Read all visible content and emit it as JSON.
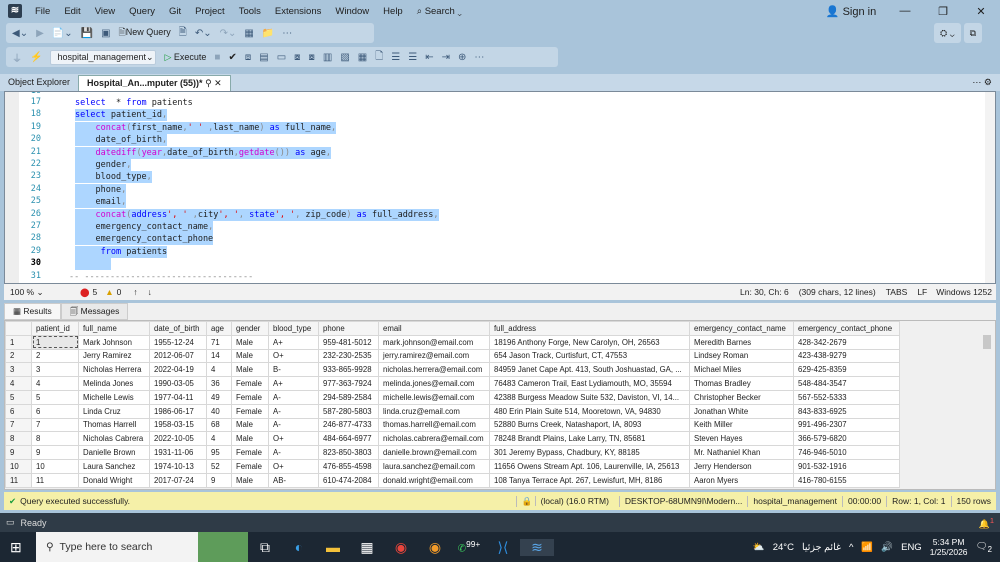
{
  "menu": {
    "items": [
      "File",
      "Edit",
      "View",
      "Query",
      "Git",
      "Project",
      "Tools",
      "Extensions",
      "Window",
      "Help"
    ],
    "search": "Search",
    "sign_in": "Sign in"
  },
  "toolbar": {
    "new_query": "New Query",
    "database": "hospital_management",
    "execute": "Execute"
  },
  "tabs": {
    "object_explorer": "Object Explorer",
    "query_tab": "Hospital_An...mputer (55))*"
  },
  "editor": {
    "first_line_partial": "16",
    "lines": [
      {
        "n": "17",
        "sel": false,
        "t": [
          [
            "kw",
            "select"
          ],
          [
            "",
            "  * "
          ],
          [
            "kw",
            "from"
          ],
          [
            "",
            " patients"
          ]
        ]
      },
      {
        "n": "18",
        "sel": true,
        "t": [
          [
            "kw",
            "select"
          ],
          [
            "",
            " patient_id"
          ],
          [
            "gr",
            ","
          ]
        ]
      },
      {
        "n": "19",
        "sel": true,
        "t": [
          [
            "",
            " "
          ],
          [
            "fn",
            "concat"
          ],
          [
            "gr",
            "("
          ],
          [
            "",
            "first_name"
          ],
          [
            "gr",
            ","
          ],
          [
            "str",
            "' '"
          ],
          [
            "gr",
            " ,"
          ],
          [
            "",
            "last_name"
          ],
          [
            "gr",
            ")"
          ],
          [
            "",
            " "
          ],
          [
            "kw",
            "as"
          ],
          [
            "",
            " full_name"
          ],
          [
            "gr",
            ","
          ]
        ]
      },
      {
        "n": "20",
        "sel": true,
        "t": [
          [
            "",
            " date_of_birth"
          ],
          [
            "gr",
            ","
          ]
        ]
      },
      {
        "n": "21",
        "sel": true,
        "t": [
          [
            "",
            " "
          ],
          [
            "fn",
            "datediff"
          ],
          [
            "gr",
            "("
          ],
          [
            "fn",
            "year"
          ],
          [
            "gr",
            ","
          ],
          [
            "",
            "date_of_birth"
          ],
          [
            "gr",
            ","
          ],
          [
            "fn",
            "getdate"
          ],
          [
            "gr",
            "())"
          ],
          [
            "",
            " "
          ],
          [
            "kw",
            "as"
          ],
          [
            "",
            " age"
          ],
          [
            "gr",
            ","
          ]
        ]
      },
      {
        "n": "22",
        "sel": true,
        "t": [
          [
            "",
            " gender"
          ],
          [
            "gr",
            ","
          ]
        ]
      },
      {
        "n": "23",
        "sel": true,
        "t": [
          [
            "",
            " blood_type"
          ],
          [
            "gr",
            ","
          ]
        ]
      },
      {
        "n": "24",
        "sel": true,
        "t": [
          [
            "",
            " phone"
          ],
          [
            "gr",
            ","
          ]
        ]
      },
      {
        "n": "25",
        "sel": true,
        "t": [
          [
            "",
            " email"
          ],
          [
            "gr",
            ","
          ]
        ]
      },
      {
        "n": "26",
        "sel": true,
        "t": [
          [
            "",
            " "
          ],
          [
            "fn",
            "concat"
          ],
          [
            "gr",
            "("
          ],
          [
            "kw",
            "address"
          ],
          [
            "str",
            "', '"
          ],
          [
            "gr",
            " ,"
          ],
          [
            "",
            "city"
          ],
          [
            "str",
            "', '"
          ],
          [
            "gr",
            ","
          ],
          [
            "kw",
            " state"
          ],
          [
            "str",
            "', '"
          ],
          [
            "gr",
            ","
          ],
          [
            "",
            " zip_code"
          ],
          [
            "gr",
            ")"
          ],
          [
            "",
            " "
          ],
          [
            "kw",
            "as"
          ],
          [
            "",
            " full_address"
          ],
          [
            "gr",
            ","
          ]
        ]
      },
      {
        "n": "27",
        "sel": true,
        "t": [
          [
            "",
            " emergency_contact_name"
          ],
          [
            "gr",
            ","
          ]
        ]
      },
      {
        "n": "28",
        "sel": true,
        "t": [
          [
            "",
            " emergency_contact_phone"
          ]
        ]
      },
      {
        "n": "29",
        "sel": true,
        "t": [
          [
            "",
            "  "
          ],
          [
            "kw",
            "from"
          ],
          [
            "",
            " patients"
          ]
        ]
      },
      {
        "n": "30",
        "sel": true,
        "t": [
          [
            "",
            "    "
          ]
        ]
      },
      {
        "n": "31",
        "sel": false,
        "t": [
          [
            "gr",
            "-- ---------------------------------"
          ]
        ]
      }
    ]
  },
  "editor_status": {
    "zoom": "100 %",
    "errors": "5",
    "warnings": "0",
    "position": "Ln: 30, Ch: 6",
    "chars": "(309 chars, 12 lines)",
    "tabs": "TABS",
    "eol": "LF",
    "encoding": "Windows 1252"
  },
  "results": {
    "tab_results": "Results",
    "tab_messages": "Messages",
    "columns": [
      "patient_id",
      "full_name",
      "date_of_birth",
      "age",
      "gender",
      "blood_type",
      "phone",
      "email",
      "full_address",
      "emergency_contact_name",
      "emergency_contact_phone"
    ],
    "rows": [
      [
        "1",
        "Mark Johnson",
        "1955-12-24",
        "71",
        "Male",
        "A+",
        "959-481-5012",
        "mark.johnson@email.com",
        "18196 Anthony Forge, New Carolyn, OH, 26563",
        "Meredith Barnes",
        "428-342-2679"
      ],
      [
        "2",
        "Jerry Ramirez",
        "2012-06-07",
        "14",
        "Male",
        "O+",
        "232-230-2535",
        "jerry.ramirez@email.com",
        "654 Jason Track, Curtisfurt, CT, 47553",
        "Lindsey Roman",
        "423-438-9279"
      ],
      [
        "3",
        "Nicholas Herrera",
        "2022-04-19",
        "4",
        "Male",
        "B-",
        "933-865-9928",
        "nicholas.herrera@email.com",
        "84959 Janet Cape Apt. 413, South Joshuastad, GA, ...",
        "Michael Miles",
        "629-425-8359"
      ],
      [
        "4",
        "Melinda Jones",
        "1990-03-05",
        "36",
        "Female",
        "A+",
        "977-363-7924",
        "melinda.jones@email.com",
        "76483 Cameron Trail, East Lydiamouth, MO, 35594",
        "Thomas Bradley",
        "548-484-3547"
      ],
      [
        "5",
        "Michelle Lewis",
        "1977-04-11",
        "49",
        "Female",
        "A-",
        "294-589-2584",
        "michelle.lewis@email.com",
        "42388 Burgess Meadow Suite 532, Daviston, VI, 14...",
        "Christopher Becker",
        "567-552-5333"
      ],
      [
        "6",
        "Linda Cruz",
        "1986-06-17",
        "40",
        "Female",
        "A-",
        "587-280-5803",
        "linda.cruz@email.com",
        "480 Erin Plain Suite 514, Mooretown, VA, 94830",
        "Jonathan White",
        "843-833-6925"
      ],
      [
        "7",
        "Thomas Harrell",
        "1958-03-15",
        "68",
        "Male",
        "A-",
        "246-877-4733",
        "thomas.harrell@email.com",
        "52880 Burns Creek, Natashaport, IA, 8093",
        "Keith Miller",
        "991-496-2307"
      ],
      [
        "8",
        "Nicholas Cabrera",
        "2022-10-05",
        "4",
        "Male",
        "O+",
        "484-664-6977",
        "nicholas.cabrera@email.com",
        "78248 Brandt Plains, Lake Larry, TN, 85681",
        "Steven Hayes",
        "366-579-6820"
      ],
      [
        "9",
        "Danielle Brown",
        "1931-11-06",
        "95",
        "Female",
        "A-",
        "823-850-3803",
        "danielle.brown@email.com",
        "301 Jeremy Bypass, Chadbury, KY, 88185",
        "Mr. Nathaniel Khan",
        "746-946-5010"
      ],
      [
        "10",
        "Laura Sanchez",
        "1974-10-13",
        "52",
        "Female",
        "O+",
        "476-855-4598",
        "laura.sanchez@email.com",
        "11656 Owens Stream Apt. 106, Laurenville, IA, 25613",
        "Jerry Henderson",
        "901-532-1916"
      ],
      [
        "11",
        "Donald Wright",
        "2017-07-24",
        "9",
        "Male",
        "AB-",
        "610-474-2084",
        "donald.wright@email.com",
        "108 Tanya Terrace Apt. 267, Lewisfurt, MH, 8186",
        "Aaron Myers",
        "416-780-6155"
      ]
    ]
  },
  "query_status": {
    "message": "Query executed successfully.",
    "server": "(local) (16.0 RTM)",
    "connection": "DESKTOP-68UMN9I\\Modern...",
    "database": "hospital_management",
    "elapsed": "00:00:00",
    "cursor": "Row: 1, Col: 1",
    "rows": "150 rows"
  },
  "app_status": {
    "text": "Ready",
    "notifications": "1"
  },
  "taskbar": {
    "search_placeholder": "Type here to search",
    "weather_temp": "24°C",
    "weather_text": "غائم جزئيا",
    "language": "ENG",
    "time": "5:34 PM",
    "date": "1/25/2026",
    "whatsapp_badge": "99+",
    "notif_count": "2"
  }
}
